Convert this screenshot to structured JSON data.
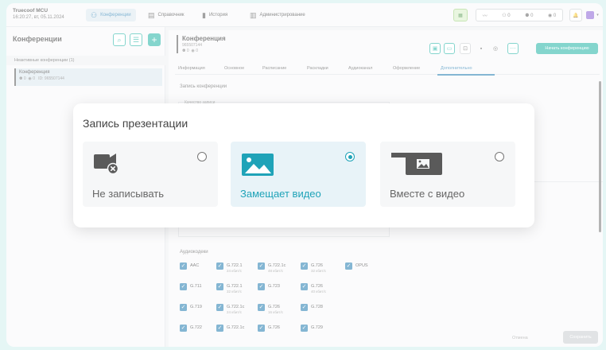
{
  "app": {
    "title": "Truecoof MCU",
    "datetime": "16:20:27, вт, 05.11.2024"
  },
  "nav": {
    "conferences": "Конференции",
    "directory": "Справочник",
    "history": "История",
    "admin": "Администрирование"
  },
  "status": {
    "a": "0",
    "b": "0",
    "c": "0"
  },
  "left": {
    "title": "Конференции",
    "inactive_header": "Неактивные конференции (1)",
    "item": {
      "name": "Конференция",
      "participants": "0",
      "viewers": "0",
      "id": "ID: 965507144"
    }
  },
  "conference": {
    "name": "Конференция",
    "id": "965507144",
    "participants": "0",
    "viewers": "0",
    "start_label": "Начать конференцию"
  },
  "tabs": [
    "Информация",
    "Основное",
    "Расписание",
    "Раскладки",
    "Аудиоканал",
    "Оформление",
    "Дополнительно"
  ],
  "form": {
    "section": "Запись конференции",
    "quality_label": "Качество записи",
    "codecs_label": "Аудиокодеки",
    "cancel": "Отмена",
    "save": "Сохранить"
  },
  "codecs": [
    {
      "name": "AAC",
      "sub": ""
    },
    {
      "name": "G.722.1",
      "sub": "24 кбит/с"
    },
    {
      "name": "G.722.1c",
      "sub": "48 кбит/с"
    },
    {
      "name": "G.726",
      "sub": "32 кбит/с"
    },
    {
      "name": "OPUS",
      "sub": ""
    },
    {
      "name": "G.711",
      "sub": ""
    },
    {
      "name": "G.722.1",
      "sub": "32 кбит/с"
    },
    {
      "name": "G.723",
      "sub": ""
    },
    {
      "name": "G.726",
      "sub": "40 кбит/с"
    },
    {
      "name": "G.719",
      "sub": ""
    },
    {
      "name": "G.722.1c",
      "sub": "24 кбит/с"
    },
    {
      "name": "G.726",
      "sub": "16 кбит/с"
    },
    {
      "name": "G.728",
      "sub": ""
    },
    {
      "name": "G.722",
      "sub": ""
    },
    {
      "name": "G.722.1c",
      "sub": ""
    },
    {
      "name": "G.726",
      "sub": ""
    },
    {
      "name": "G.729",
      "sub": ""
    }
  ],
  "modal": {
    "title": "Запись презентации",
    "options": [
      {
        "label": "Не записывать",
        "selected": false
      },
      {
        "label": "Замещает видео",
        "selected": true
      },
      {
        "label": "Вместе с видео",
        "selected": false
      }
    ]
  },
  "colors": {
    "accent": "#1fb3a5",
    "link": "#1f7bb0",
    "selected_label": "#1fa3b8"
  }
}
